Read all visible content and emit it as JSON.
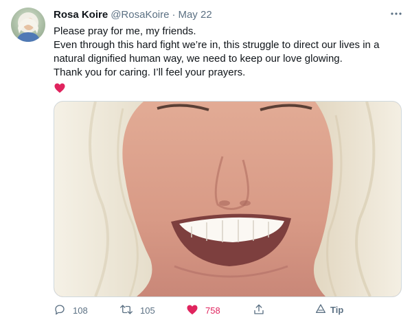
{
  "tweet": {
    "author_name": "Rosa Koire",
    "author_handle": "@RosaKoire",
    "separator": "·",
    "date": "May 22",
    "lines": [
      "Please pray for me, my friends.",
      "Even through this hard fight we’re in, this struggle to direct our lives in a natural dignified human way, we need to keep our love glowing.",
      "Thank you for caring. I’ll feel your prayers."
    ],
    "emoji": "red-heart-emoji"
  },
  "actions": {
    "reply_count": "108",
    "retweet_count": "105",
    "like_count": "758",
    "tip_label": "Tip"
  },
  "colors": {
    "like": "#e0245e",
    "secondary_text": "#5b7083",
    "border": "#cfd9de"
  },
  "icons": [
    "more-icon",
    "reply-icon",
    "retweet-icon",
    "like-icon",
    "share-icon",
    "tip-icon"
  ]
}
